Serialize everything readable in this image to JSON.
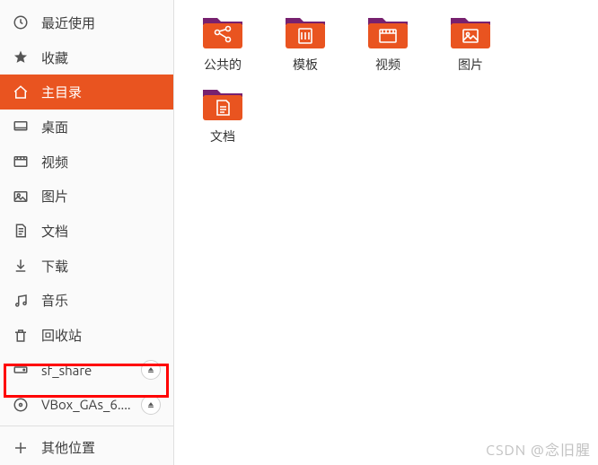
{
  "sidebar": {
    "items": [
      {
        "label": "最近使用",
        "icon": "clock-icon",
        "active": false
      },
      {
        "label": "收藏",
        "icon": "star-icon",
        "active": false
      },
      {
        "label": "主目录",
        "icon": "home-icon",
        "active": true
      },
      {
        "label": "桌面",
        "icon": "desktop-icon",
        "active": false
      },
      {
        "label": "视频",
        "icon": "video-icon",
        "active": false
      },
      {
        "label": "图片",
        "icon": "pictures-icon",
        "active": false
      },
      {
        "label": "文档",
        "icon": "documents-icon",
        "active": false
      },
      {
        "label": "下载",
        "icon": "downloads-icon",
        "active": false
      },
      {
        "label": "音乐",
        "icon": "music-icon",
        "active": false
      },
      {
        "label": "回收站",
        "icon": "trash-icon",
        "active": false
      },
      {
        "label": "sf_share",
        "icon": "drive-icon",
        "active": false,
        "ejectable": true
      },
      {
        "label": "VBox_GAs_6....",
        "icon": "disc-icon",
        "active": false,
        "ejectable": true
      },
      {
        "label": "其他位置",
        "icon": "plus-icon",
        "active": false,
        "divider_before": true
      }
    ]
  },
  "folders": [
    {
      "label": "公共的",
      "icon": "share"
    },
    {
      "label": "模板",
      "icon": "templates"
    },
    {
      "label": "视频",
      "icon": "videos"
    },
    {
      "label": "图片",
      "icon": "pictures"
    },
    {
      "label": "文档",
      "icon": "documents"
    }
  ],
  "watermark": "CSDN @念旧腥",
  "colors": {
    "accent": "#e95420",
    "folder_body": "#e95420",
    "folder_tab": "#77216f"
  }
}
